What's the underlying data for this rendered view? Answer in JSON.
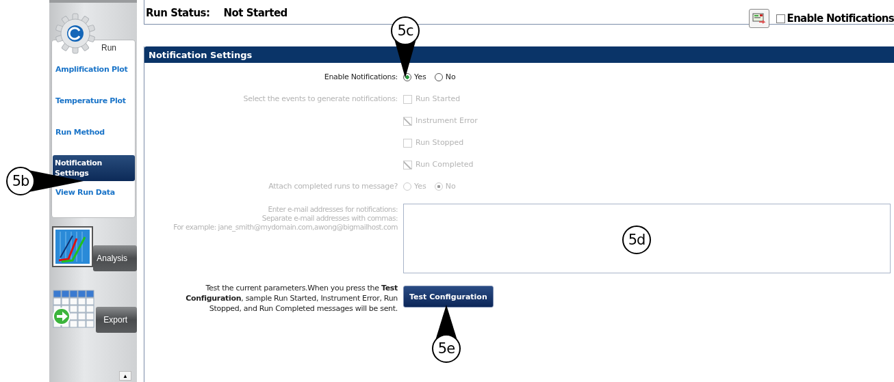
{
  "sidebar": {
    "sections": [
      {
        "label": "Run",
        "kind": "run",
        "items": [
          {
            "label": "Amplification Plot",
            "selected": false
          },
          {
            "label": "Temperature Plot",
            "selected": false
          },
          {
            "label": "Run Method",
            "selected": false
          },
          {
            "label": "Notification Settings",
            "selected": true
          },
          {
            "label": "View Run Data",
            "selected": false
          }
        ]
      },
      {
        "label": "Analysis",
        "kind": "analysis"
      },
      {
        "label": "Export",
        "kind": "export"
      }
    ],
    "scroll_up": "▲"
  },
  "run_status": {
    "label": "Run Status:",
    "value": "Not Started"
  },
  "toolbar": {
    "enable_notifications": {
      "label": "Enable Notifications",
      "checked": false
    }
  },
  "panel": {
    "title": "Notification Settings",
    "enable": {
      "label": "Enable Notifications:",
      "options": [
        {
          "label": "Yes",
          "selected": true
        },
        {
          "label": "No",
          "selected": false
        }
      ]
    },
    "events": {
      "label": "Select the events to generate notifications:",
      "disabled": true,
      "options": [
        {
          "label": "Run Started",
          "checked": false
        },
        {
          "label": "Instrument Error",
          "checked": true
        },
        {
          "label": "Run Stopped",
          "checked": false
        },
        {
          "label": "Run Completed",
          "checked": true
        }
      ]
    },
    "attach": {
      "label": "Attach completed runs to message?",
      "disabled": true,
      "options": [
        {
          "label": "Yes",
          "selected": false
        },
        {
          "label": "No",
          "selected": true
        }
      ]
    },
    "email": {
      "disabled": true,
      "instructions": [
        "Enter e-mail addresses for notifications:",
        "Separate e-mail addresses with commas:",
        "For example: jane_smith@mydomain.com,awong@bigmailhost.com"
      ]
    },
    "test": {
      "description": "Test the current parameters.When you press the **Test Configuration**, sample Run Started, Instrument Error, Run Stopped, and Run Completed messages will be sent.",
      "button": "Test Configuration"
    }
  },
  "callouts": [
    {
      "label": "5b"
    },
    {
      "label": "5c"
    },
    {
      "label": "5d"
    },
    {
      "label": "5e"
    }
  ]
}
